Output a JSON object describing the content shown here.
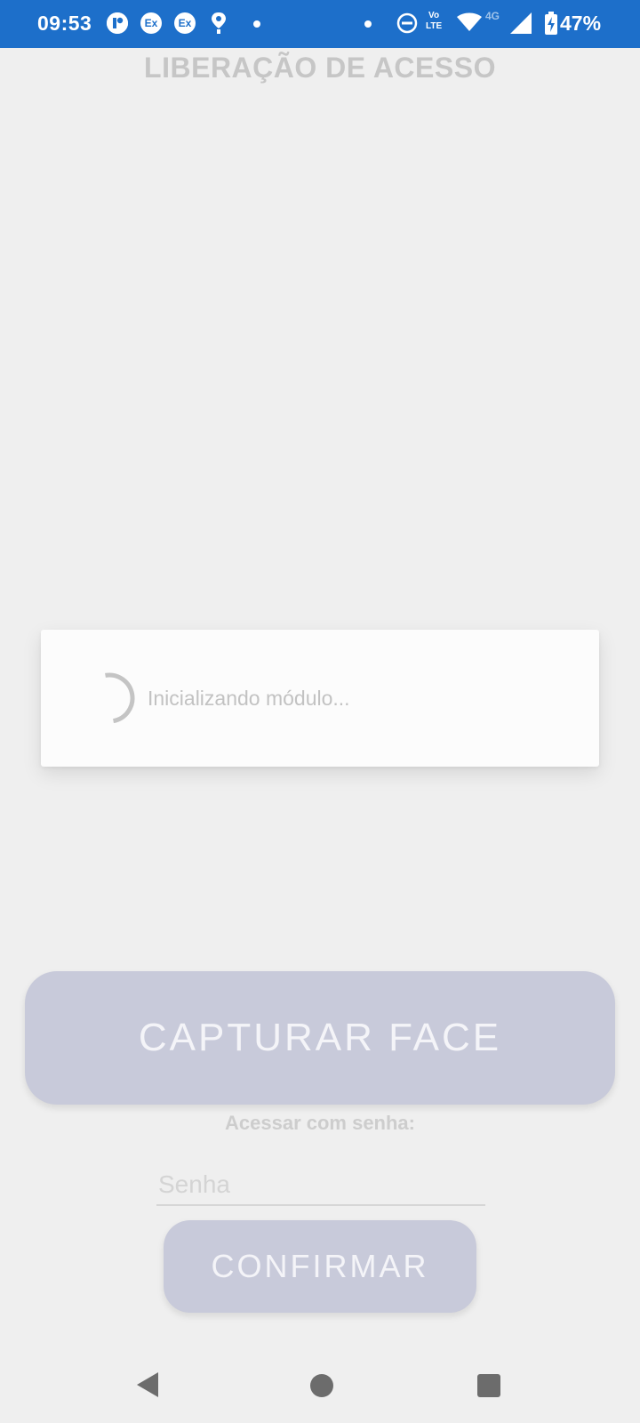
{
  "status_bar": {
    "time": "09:53",
    "icons_left": [
      "notification-app-icon",
      "ex-icon",
      "ex-icon",
      "location-icon",
      "dot-icon"
    ],
    "ex_label": "Ex",
    "volte_label_top": "Vo",
    "volte_label_bottom": "LTE",
    "network_type": "4G",
    "battery_percent": "47%",
    "color": "#1d6fca"
  },
  "header": {
    "title": "LIBERAÇÃO DE ACESSO"
  },
  "dialog": {
    "message": "Inicializando módulo..."
  },
  "main": {
    "capture_button": "CAPTURAR FACE",
    "password_label": "Acessar com senha:",
    "password_placeholder": "Senha",
    "confirm_button": "CONFIRMAR",
    "button_color": "#c8cada"
  },
  "nav_bar": {
    "icons": [
      "back-icon",
      "home-icon",
      "recents-icon"
    ]
  }
}
